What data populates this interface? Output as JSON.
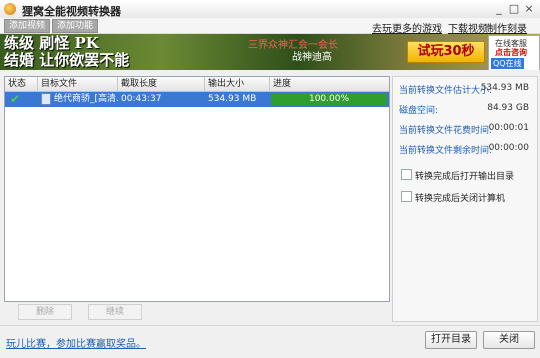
{
  "window": {
    "title": "狸窝全能视频转换器",
    "controls": [
      "_",
      "□",
      "×"
    ]
  },
  "toolbar": {
    "buttons": [
      "添加视频",
      "添加功能"
    ],
    "links": [
      "去玩更多的游戏",
      "下载视频",
      "制作刻录DVD"
    ]
  },
  "banner": {
    "left_text_1": "练级 刷怪 PK",
    "left_text_2": "结婚 让你欲罢不能",
    "mid_text_1": "三界众神汇会一会长",
    "mid_text_2": "战神迪高",
    "play_label": "试玩30秒",
    "online_1": "在线客服",
    "online_2": "点击咨询",
    "online_3": "QQ在线"
  },
  "list": {
    "columns": [
      "状态",
      "目标文件",
      "截取长度",
      "输出大小",
      "进度"
    ],
    "rows": [
      {
        "status": "✔",
        "file": "绝代商骄_[高清...",
        "length": "00:43:37",
        "size": "534.93 MB",
        "progress": "100.00%"
      }
    ]
  },
  "list_buttons": [
    "删除",
    "继续"
  ],
  "info": {
    "rows": [
      {
        "label": "当前转换文件估计大小:",
        "value": "534.93 MB"
      },
      {
        "label": "磁盘空间:",
        "value": "84.93 GB"
      },
      {
        "label": "当前转换文件花费时间:",
        "value": "00:00:01"
      },
      {
        "label": "当前转换文件剩余时间:",
        "value": "00:00:00"
      }
    ],
    "checkboxes": [
      "转换完成后打开输出目录",
      "转换完成后关闭计算机"
    ]
  },
  "footer": {
    "link": "玩儿比赛，参加比赛赢取奖品。",
    "open_button": "打开目录",
    "close_button": "关闭"
  }
}
